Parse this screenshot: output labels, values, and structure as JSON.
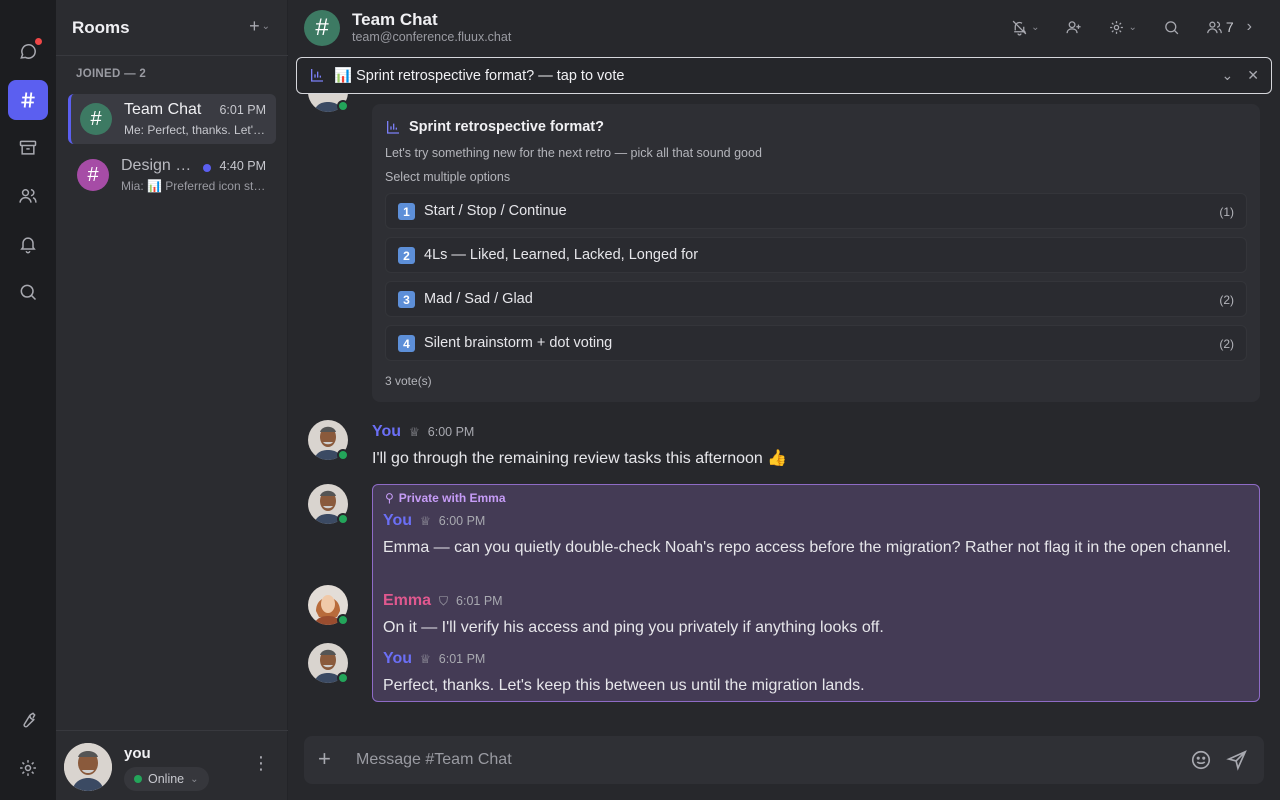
{
  "rail": {
    "items": [
      "chat",
      "rooms",
      "archive",
      "contacts",
      "notifications",
      "search"
    ],
    "bottom": [
      "tools",
      "settings"
    ]
  },
  "sidebar": {
    "title": "Rooms",
    "joined_label": "JOINED — 2",
    "rooms": [
      {
        "name": "Team Chat",
        "time": "6:01 PM",
        "preview": "Me: Perfect, thanks. Let's keep this between us",
        "color": "#3d7a63"
      },
      {
        "name": "Design Review",
        "time": "4:40 PM",
        "preview": "Mia: 📊 Preferred icon style",
        "color": "#a64ca6"
      }
    ],
    "user": {
      "name": "you",
      "status": "Online"
    }
  },
  "header": {
    "title": "Team Chat",
    "subtitle": "team@conference.fluux.chat",
    "member_count": "7"
  },
  "banner": {
    "text": "📊 Sprint retrospective format? — tap to vote"
  },
  "poll": {
    "question": "Sprint retrospective format?",
    "description": "Let's try something new for the next retro — pick all that sound good",
    "mode": "Select multiple options",
    "options": [
      {
        "num": "1",
        "label": "Start / Stop / Continue",
        "count": "(1)"
      },
      {
        "num": "2",
        "label": "4Ls — Liked, Learned, Lacked, Longed for",
        "count": ""
      },
      {
        "num": "3",
        "label": "Mad / Sad / Glad",
        "count": "(2)"
      },
      {
        "num": "4",
        "label": "Silent brainstorm + dot voting",
        "count": "(2)"
      }
    ],
    "votes": "3 vote(s)"
  },
  "messages": [
    {
      "author": "You",
      "time": "6:00 PM",
      "text": "I'll go through the remaining review tasks this afternoon 👍"
    }
  ],
  "private": {
    "label": "Private with Emma",
    "messages": [
      {
        "author": "You",
        "time": "6:00 PM",
        "text": "Emma — can you quietly double-check Noah's repo access before the migration? Rather not flag it in the open channel."
      },
      {
        "author": "Emma",
        "time": "6:01 PM",
        "text": "On it — I'll verify his access and ping you privately if anything looks off."
      },
      {
        "author": "You",
        "time": "6:01 PM",
        "text": "Perfect, thanks. Let's keep this between us until the migration lands."
      }
    ]
  },
  "composer": {
    "placeholder": "Message #Team Chat"
  }
}
